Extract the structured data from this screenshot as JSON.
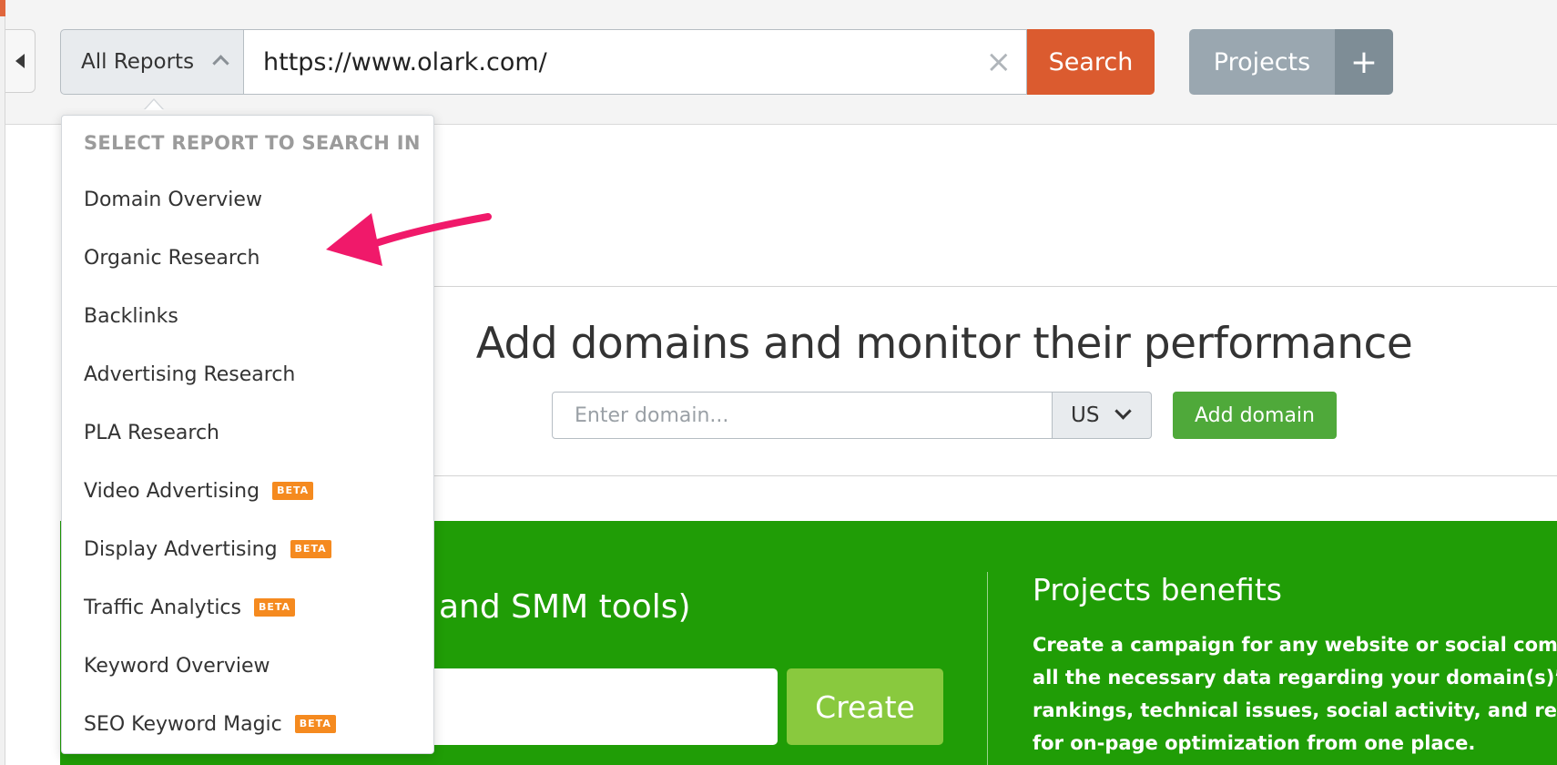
{
  "search": {
    "report_select_label": "All Reports",
    "url_value": "https://www.olark.com/",
    "clear_glyph": "×",
    "search_label": "Search"
  },
  "projects": {
    "label": "Projects",
    "plus_glyph": "+"
  },
  "dropdown": {
    "header": "SELECT REPORT TO SEARCH IN",
    "items": [
      {
        "label": "Domain Overview",
        "beta": ""
      },
      {
        "label": "Organic Research",
        "beta": ""
      },
      {
        "label": "Backlinks",
        "beta": ""
      },
      {
        "label": "Advertising Research",
        "beta": ""
      },
      {
        "label": "PLA Research",
        "beta": ""
      },
      {
        "label": "Video Advertising",
        "beta": "BETA"
      },
      {
        "label": "Display Advertising",
        "beta": "BETA"
      },
      {
        "label": "Traffic Analytics",
        "beta": "BETA"
      },
      {
        "label": "Keyword Overview",
        "beta": ""
      },
      {
        "label": "SEO Keyword Magic",
        "beta": "BETA"
      }
    ]
  },
  "monitor": {
    "title": "Add domains and monitor their performance",
    "domain_placeholder": "Enter domain...",
    "country": "US",
    "add_label": "Add domain"
  },
  "create_project": {
    "partial_heading": "and SMM tools)",
    "create_label": "Create"
  },
  "benefits": {
    "title": "Projects benefits",
    "lines": [
      "Create a campaign for any website or social communi",
      "all the necessary data regarding your domain(s)’ keyw",
      "rankings, technical issues, social activity, and recomm",
      "for on-page optimization from one place."
    ]
  },
  "colors": {
    "search_orange": "#db5b2f",
    "projects_gray": "#9aa7b0",
    "add_domain_green": "#4fa93a",
    "panel_green": "#209d06",
    "create_green": "#89c93e",
    "beta_orange": "#f58a1f",
    "annotation_arrow": "#f0196a"
  },
  "icons": {
    "collapse": "triangle-left-icon",
    "select_open": "chevron-up-icon",
    "country_dropdown": "chevron-down-icon",
    "clear": "close-icon",
    "add": "plus-icon",
    "annotation": "annotation-arrow"
  }
}
